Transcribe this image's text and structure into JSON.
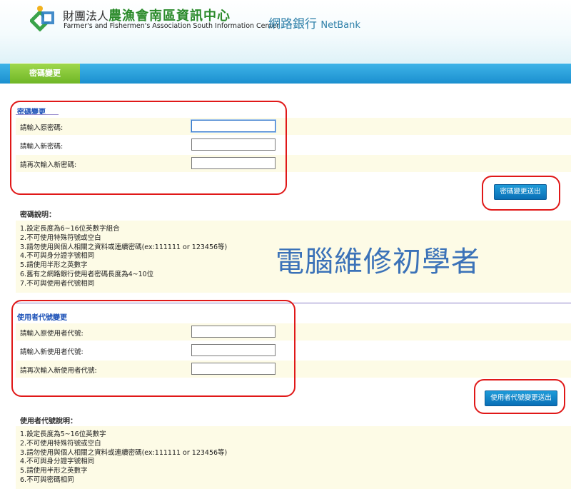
{
  "header": {
    "org_prefix": "財團法人",
    "org_name": "農漁會南區資訊中心",
    "org_en": "Farmer's and Fishermen's Association South Information Center",
    "product_cn": "網路銀行",
    "product_en": "NetBank"
  },
  "tabs": [
    {
      "label": "密碼變更",
      "active": true
    }
  ],
  "password_section": {
    "title": "密碼變更",
    "fields": [
      {
        "label": "請輸入原密碼:",
        "value": ""
      },
      {
        "label": "請輸入新密碼:",
        "value": ""
      },
      {
        "label": "請再次輸入新密碼:",
        "value": ""
      }
    ],
    "submit_label": "密碼變更送出",
    "notes_title": "密碼說明：",
    "notes": [
      "1.設定長度為6~16位英數字組合",
      "2.不可使用特殊符號或空白",
      "3.請勿使用與個人相關之資料或連續密碼(ex:111111 or 123456等)",
      "4.不可與身分證字號相同",
      "5.請使用半形之英數字",
      "6.舊有之網路銀行使用者密碼長度為4~10位",
      "7.不可與使用者代號相同"
    ]
  },
  "userid_section": {
    "title": "使用者代號變更",
    "fields": [
      {
        "label": "請輸入原使用者代號:",
        "value": ""
      },
      {
        "label": "請輸入新使用者代號:",
        "value": ""
      },
      {
        "label": "請再次輸入新使用者代號:",
        "value": ""
      }
    ],
    "submit_label": "使用者代號變更送出",
    "notes_title": "使用者代號說明：",
    "notes": [
      "1.設定長度為5~16位英數字",
      "2.不可使用特殊符號或空白",
      "3.請勿使用與個人相關之資料或連續密碼(ex:111111 or 123456等)",
      "4.不可與身分證字號相同",
      "5.請使用半形之英數字",
      "6.不可與密碼相同"
    ]
  },
  "watermark": "電腦維修初學者",
  "colors": {
    "tabbar": "#1b8fcf",
    "tab_active": "#6fb626",
    "section_title": "#1d52b8",
    "button": "#0a6fb6",
    "highlight": "#e01818",
    "row_shade": "#fdfbe6"
  }
}
